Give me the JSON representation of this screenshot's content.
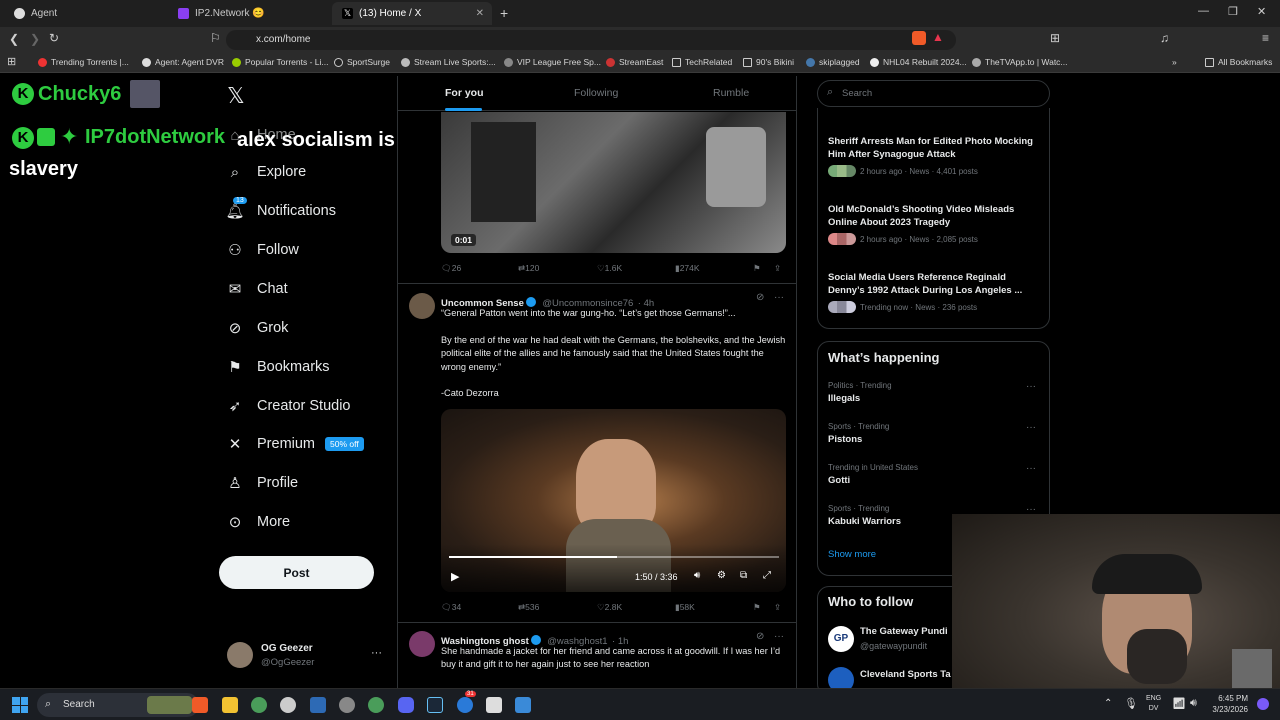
{
  "browser": {
    "tabs": [
      {
        "label": "Agent",
        "active": false
      },
      {
        "label": "IP2.Network 😊",
        "active": false
      },
      {
        "label": "(13) Home / X",
        "active": true
      }
    ],
    "url": "x.com/home",
    "bookmarks": [
      "Trending Torrents |...",
      "Agent: Agent DVR",
      "Popular Torrents - Li...",
      "SportSurge",
      "Stream Live Sports:...",
      "VIP League Free Sp...",
      "StreamEast",
      "TechRelated",
      "90's Bikini",
      "skiplagged",
      "NHL04 Rebuilt 2024...",
      "TheTVApp.to | Watc..."
    ],
    "all_bookmarks": "All Bookmarks"
  },
  "overlay": {
    "user1": "Chucky6",
    "user2": "IP7dotNetwork",
    "message": "alex socialism is slavery"
  },
  "nav": {
    "home_label": "Home",
    "items": [
      {
        "label": "Explore",
        "icon": "search-icon"
      },
      {
        "label": "Notifications",
        "icon": "bell-icon",
        "badge": "13"
      },
      {
        "label": "Follow",
        "icon": "person-add-icon"
      },
      {
        "label": "Chat",
        "icon": "mail-icon"
      },
      {
        "label": "Grok",
        "icon": "grok-icon"
      },
      {
        "label": "Bookmarks",
        "icon": "bookmark-icon"
      },
      {
        "label": "Creator Studio",
        "icon": "rocket-icon"
      },
      {
        "label": "Premium",
        "icon": "x-icon",
        "badge": "50% off"
      },
      {
        "label": "Profile",
        "icon": "person-icon"
      },
      {
        "label": "More",
        "icon": "more-icon"
      }
    ],
    "post_label": "Post",
    "account": {
      "name": "OG Geezer",
      "handle": "@OgGeezer"
    }
  },
  "feed": {
    "tabs": [
      "For you",
      "Following",
      "Rumble"
    ],
    "tweet0": {
      "duration": "0:01",
      "replies": "26",
      "reposts": "120",
      "likes": "1.6K",
      "views": "274K"
    },
    "tweet1": {
      "name": "Uncommon Sense",
      "handle": "@Uncommonsince76",
      "time": "· 4h",
      "line1": "“General Patton went into the war gung-ho. “Let’s get those Germans!”...",
      "line2": "By the end of the war he had dealt with the Germans, the bolsheviks, and the Jewish political elite of the allies and he famously said that the United States fought the wrong enemy.”",
      "line3": "-Cato Dezorra",
      "video_time": "1:50 / 3:36",
      "replies": "34",
      "reposts": "536",
      "likes": "2.8K",
      "views": "58K"
    },
    "tweet2": {
      "name": "Washingtons ghost",
      "handle": "@washghost1",
      "time": "· 1h",
      "text": "She handmade a jacket for her friend and came across it at goodwill. If I was her I’d buy it and gift it to her again just to see her reaction"
    }
  },
  "right": {
    "search_placeholder": "Search",
    "news": [
      {
        "title": "Sheriff Arrests Man for Edited Photo Mocking Him After Synagogue Attack",
        "meta": "2 hours ago · News · 4,401 posts"
      },
      {
        "title": "Old McDonald’s Shooting Video Misleads Online About 2023 Tragedy",
        "meta": "2 hours ago · News · 2,085 posts"
      },
      {
        "title": "Social Media Users Reference Reginald Denny’s 1992 Attack During Los Angeles ...",
        "meta": "Trending now · News · 236 posts"
      }
    ],
    "happening_title": "What’s happening",
    "trends": [
      {
        "category": "Politics · Trending",
        "name": "Illegals"
      },
      {
        "category": "Sports · Trending",
        "name": "Pistons"
      },
      {
        "category": "Trending in United States",
        "name": "Gotti"
      },
      {
        "category": "Sports · Trending",
        "name": "Kabuki Warriors"
      }
    ],
    "show_more": "Show more",
    "who_to_follow": "Who to follow",
    "follow": [
      {
        "name": "The Gateway Pundi",
        "handle": "@gatewaypundit"
      },
      {
        "name": "Cleveland Sports Ta",
        "handle": ""
      }
    ]
  },
  "taskbar": {
    "search": "Search",
    "lang": "ENG",
    "lang2": "DV",
    "time": "6:45 PM",
    "date": "3/23/2026",
    "badge": "31"
  },
  "colors": {
    "accent": "#1d9bf0",
    "overlay_green": "#2ecc40",
    "background": "#000000"
  }
}
